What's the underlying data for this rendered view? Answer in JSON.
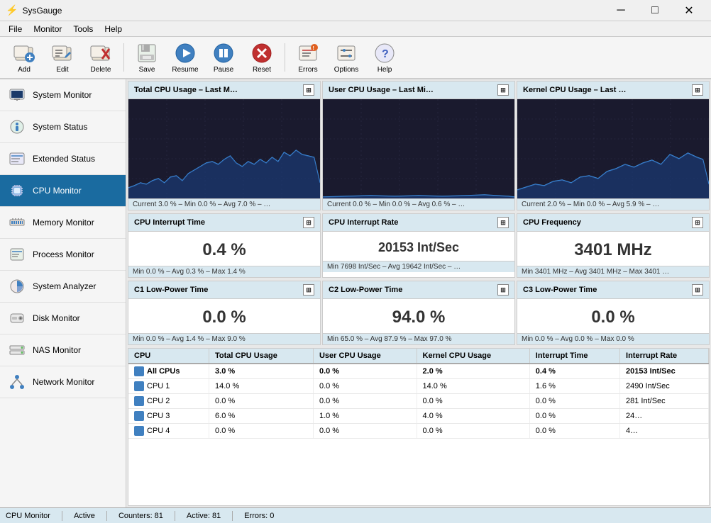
{
  "app": {
    "title": "SysGauge",
    "icon": "gauge-icon"
  },
  "titlebar": {
    "minimize": "─",
    "maximize": "□",
    "close": "✕"
  },
  "menubar": {
    "items": [
      "File",
      "Monitor",
      "Tools",
      "Help"
    ]
  },
  "toolbar": {
    "buttons": [
      {
        "label": "Add",
        "icon": "add-icon"
      },
      {
        "label": "Edit",
        "icon": "edit-icon"
      },
      {
        "label": "Delete",
        "icon": "delete-icon"
      },
      {
        "label": "Save",
        "icon": "save-icon"
      },
      {
        "label": "Resume",
        "icon": "resume-icon"
      },
      {
        "label": "Pause",
        "icon": "pause-icon"
      },
      {
        "label": "Reset",
        "icon": "reset-icon"
      },
      {
        "label": "Errors",
        "icon": "errors-icon"
      },
      {
        "label": "Options",
        "icon": "options-icon"
      },
      {
        "label": "Help",
        "icon": "help-icon"
      }
    ]
  },
  "sidebar": {
    "items": [
      {
        "label": "System Monitor",
        "icon": "system-monitor-icon",
        "active": false
      },
      {
        "label": "System Status",
        "icon": "system-status-icon",
        "active": false
      },
      {
        "label": "Extended Status",
        "icon": "extended-status-icon",
        "active": false
      },
      {
        "label": "CPU Monitor",
        "icon": "cpu-monitor-icon",
        "active": true
      },
      {
        "label": "Memory Monitor",
        "icon": "memory-monitor-icon",
        "active": false
      },
      {
        "label": "Process Monitor",
        "icon": "process-monitor-icon",
        "active": false
      },
      {
        "label": "System Analyzer",
        "icon": "system-analyzer-icon",
        "active": false
      },
      {
        "label": "Disk Monitor",
        "icon": "disk-monitor-icon",
        "active": false
      },
      {
        "label": "NAS Monitor",
        "icon": "nas-monitor-icon",
        "active": false
      },
      {
        "label": "Network Monitor",
        "icon": "network-monitor-icon",
        "active": false
      }
    ]
  },
  "charts": {
    "row1": [
      {
        "title": "Total CPU Usage – Last M…",
        "footer": "Current 3.0 % – Min 0.0 % – Avg 7.0 % – …"
      },
      {
        "title": "User CPU Usage – Last Mi…",
        "footer": "Current 0.0 % – Min 0.0 % – Avg 0.6 % – …"
      },
      {
        "title": "Kernel CPU Usage – Last …",
        "footer": "Current 2.0 % – Min 0.0 % – Avg 5.9 % – …"
      }
    ]
  },
  "metrics": {
    "row1": [
      {
        "title": "CPU Interrupt Time",
        "value": "0.4 %",
        "footer": "Min 0.0 % – Avg 0.3 % – Max 1.4 %"
      },
      {
        "title": "CPU Interrupt Rate",
        "value": "20153 Int/Sec",
        "footer": "Min 7698 Int/Sec – Avg 19642 Int/Sec – …"
      },
      {
        "title": "CPU Frequency",
        "value": "3401 MHz",
        "footer": "Min 3401 MHz – Avg 3401 MHz – Max 3401 …"
      }
    ],
    "row2": [
      {
        "title": "C1 Low-Power Time",
        "value": "0.0 %",
        "footer": "Min 0.0 % – Avg 1.4 % – Max 9.0 %"
      },
      {
        "title": "C2 Low-Power Time",
        "value": "94.0 %",
        "footer": "Min 65.0 % – Avg 87.9 % – Max 97.0 %"
      },
      {
        "title": "C3 Low-Power Time",
        "value": "0.0 %",
        "footer": "Min 0.0 % – Avg 0.0 % – Max 0.0 %"
      }
    ]
  },
  "table": {
    "columns": [
      "CPU",
      "Total CPU Usage",
      "User CPU Usage",
      "Kernel CPU Usage",
      "Interrupt Time",
      "Interrupt Rate"
    ],
    "rows": [
      {
        "cpu": "All CPUs",
        "total": "3.0 %",
        "user": "0.0 %",
        "kernel": "2.0 %",
        "interrupt_time": "0.4 %",
        "interrupt_rate": "20153 Int/Sec",
        "highlight": true
      },
      {
        "cpu": "CPU 1",
        "total": "14.0 %",
        "user": "0.0 %",
        "kernel": "14.0 %",
        "interrupt_time": "1.6 %",
        "interrupt_rate": "2490 Int/Sec"
      },
      {
        "cpu": "CPU 2",
        "total": "0.0 %",
        "user": "0.0 %",
        "kernel": "0.0 %",
        "interrupt_time": "0.0 %",
        "interrupt_rate": "281 Int/Sec"
      },
      {
        "cpu": "CPU 3",
        "total": "6.0 %",
        "user": "1.0 %",
        "kernel": "4.0 %",
        "interrupt_time": "0.0 %",
        "interrupt_rate": "24…"
      },
      {
        "cpu": "CPU 4",
        "total": "0.0 %",
        "user": "0.0 %",
        "kernel": "0.0 %",
        "interrupt_time": "0.0 %",
        "interrupt_rate": "4…"
      }
    ]
  },
  "statusbar": {
    "label": "CPU Monitor",
    "status": "Active",
    "counters": "Counters: 81",
    "active": "Active: 81",
    "errors": "Errors: 0"
  }
}
